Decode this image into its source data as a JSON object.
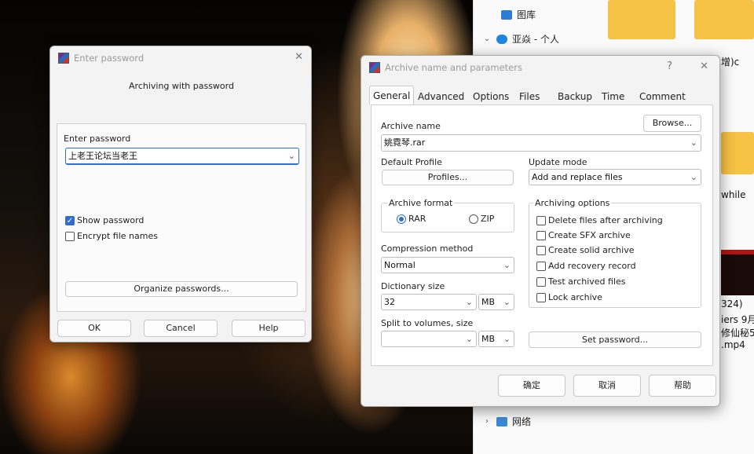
{
  "explorer": {
    "items": [
      {
        "label": "图库",
        "icon": "gallery-icon"
      },
      {
        "label": "亚焱 - 个人",
        "icon": "onedrive-icon"
      },
      {
        "label": "网络",
        "icon": "network-icon"
      }
    ],
    "fragments": [
      "增)c",
      "while",
      "324)",
      "iers 9月",
      "修仙秘5",
      ".mp4"
    ]
  },
  "password_dialog": {
    "title": "Enter password",
    "heading": "Archiving with password",
    "enter_label": "Enter password",
    "password_value": "上老王论坛当老王",
    "show_password": "Show password",
    "encrypt_names": "Encrypt file names",
    "organize": "Organize passwords...",
    "ok": "OK",
    "cancel": "Cancel",
    "help": "Help"
  },
  "archive_dialog": {
    "title": "Archive name and parameters",
    "help_glyph": "?",
    "tabs": [
      "General",
      "Advanced",
      "Options",
      "Files",
      "Backup",
      "Time",
      "Comment"
    ],
    "archive_name_label": "Archive name",
    "browse": "Browse...",
    "archive_name": "姚霓琴.rar",
    "default_profile_label": "Default Profile",
    "profiles": "Profiles...",
    "update_mode_label": "Update mode",
    "update_mode": "Add and replace files",
    "archive_format_label": "Archive format",
    "format_rar": "RAR",
    "format_zip": "ZIP",
    "archiving_options_label": "Archiving options",
    "options": [
      "Delete files after archiving",
      "Create SFX archive",
      "Create solid archive",
      "Add recovery record",
      "Test archived files",
      "Lock archive"
    ],
    "compression_label": "Compression method",
    "compression": "Normal",
    "dictionary_label": "Dictionary size",
    "dictionary": "32",
    "dictionary_unit": "MB",
    "split_label": "Split to volumes, size",
    "split_value": "",
    "split_unit": "MB",
    "set_password": "Set password...",
    "ok": "确定",
    "cancel": "取消",
    "help": "帮助"
  }
}
